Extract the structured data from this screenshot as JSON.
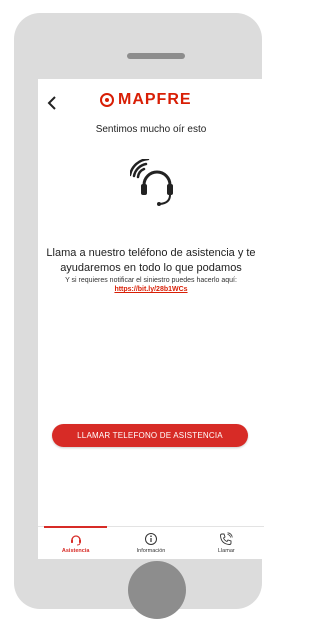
{
  "header": {
    "logo_text": "MAPFRE",
    "subtitle": "Sentimos mucho oír esto"
  },
  "message": {
    "main": "Llama a nuestro teléfono de asistencia y te ayudaremos en todo lo que podamos",
    "small": "Y si requieres notificar el siniestro puedes hacerlo aquí:",
    "link": "https://bit.ly/28b1WCs"
  },
  "actions": {
    "call_button": "LLAMAR TELEFONO DE ASISTENCIA"
  },
  "tabbar": {
    "items": [
      {
        "label": "Asistencia",
        "icon": "headset-icon",
        "active": true
      },
      {
        "label": "Información",
        "icon": "info-icon",
        "active": false
      },
      {
        "label": "Llamar",
        "icon": "phone-icon",
        "active": false
      }
    ]
  },
  "colors": {
    "brand": "#d81e05",
    "button": "#d72b26",
    "device": "#dcdcdc"
  }
}
